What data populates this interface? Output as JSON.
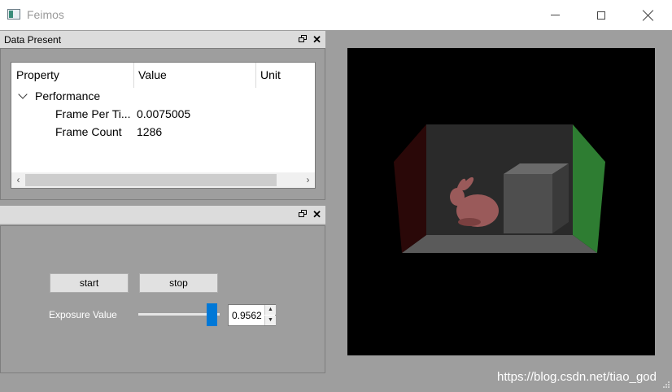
{
  "window": {
    "title": "Feimos",
    "icon": "app-window-icon"
  },
  "dock1": {
    "title": "Data Present",
    "columns": [
      "Property",
      "Value",
      "Unit"
    ],
    "group": "Performance",
    "rows": [
      {
        "property": "Frame Per Ti...",
        "value": "0.0075005",
        "unit": ""
      },
      {
        "property": "Frame Count",
        "value": "1286",
        "unit": ""
      }
    ],
    "scroll_left": "‹",
    "scroll_right": "›"
  },
  "dock2": {
    "title": "",
    "start_label": "start",
    "stop_label": "stop",
    "exposure_label": "Exposure Value",
    "exposure_value": "0.9562",
    "slider_level": 0.9562
  },
  "watermark": "https://blog.csdn.net/tiao_god",
  "colors": {
    "background": "#9e9e9e",
    "accent": "#0078d7",
    "left_wall": "#2a0808",
    "right_wall": "#2e7d32",
    "back_wall": "#2a2a2a",
    "floor": "#585858",
    "bunny": "#9a5a5a"
  }
}
